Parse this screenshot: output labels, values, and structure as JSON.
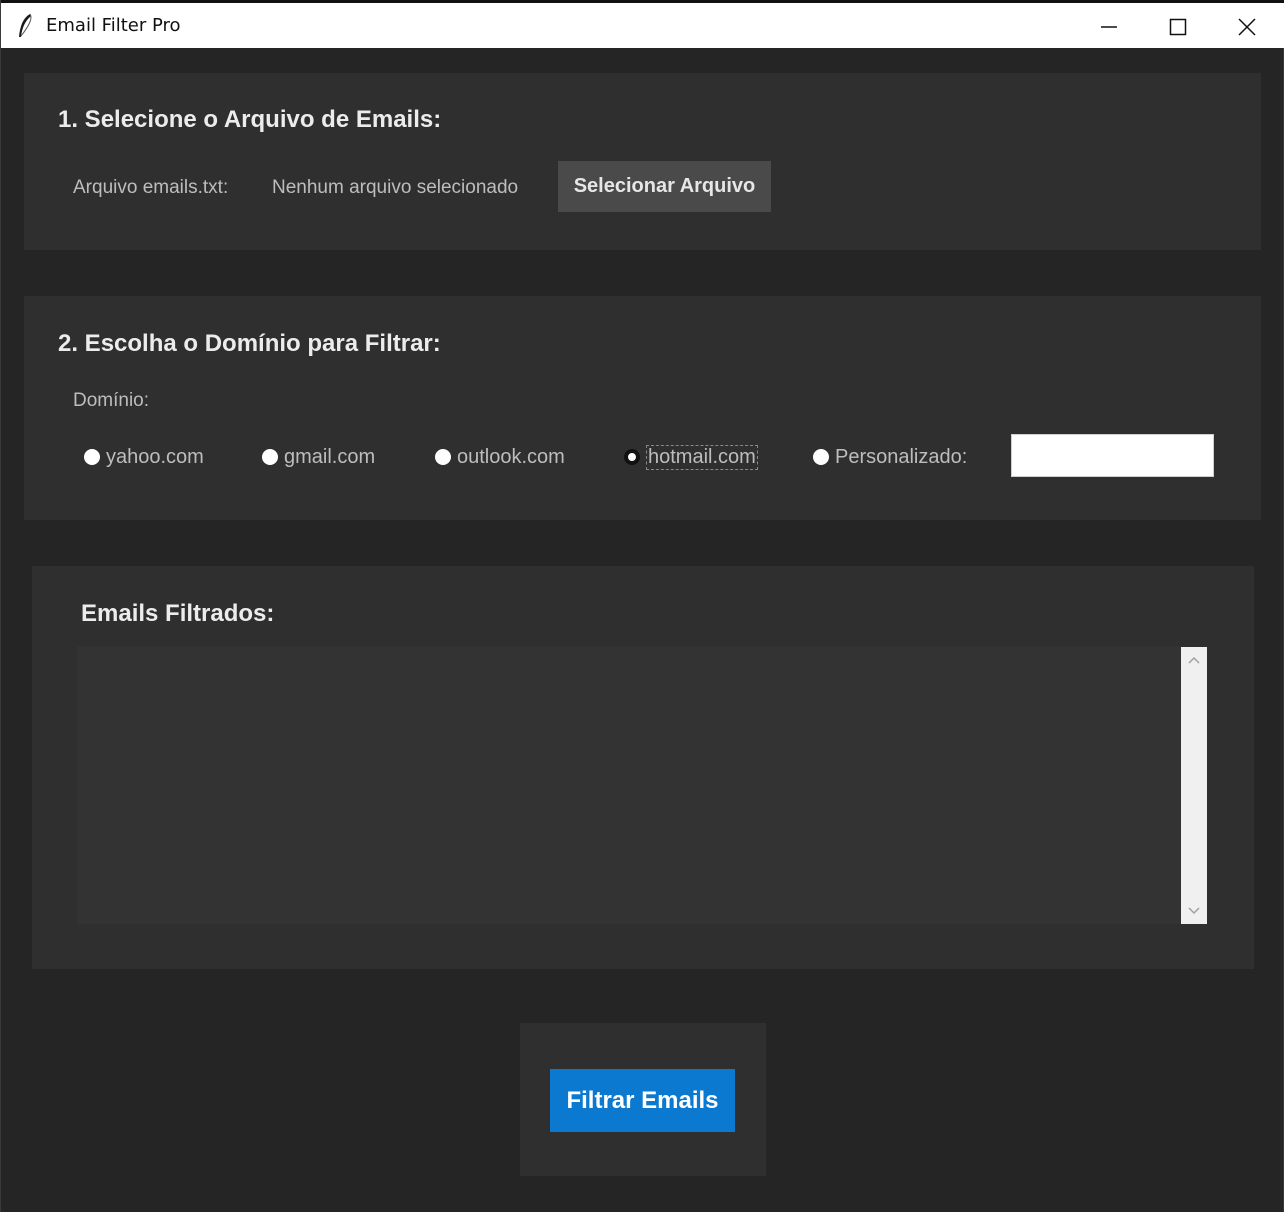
{
  "window": {
    "title": "Email Filter Pro",
    "icons": {
      "app": "feather-icon",
      "minimize": "minimize-icon",
      "maximize": "maximize-icon",
      "close": "close-icon"
    }
  },
  "section1": {
    "title": "1. Selecione o Arquivo de Emails:",
    "file_label": "Arquivo emails.txt:",
    "file_status": "Nenhum arquivo selecionado",
    "select_button": "Selecionar Arquivo"
  },
  "section2": {
    "title": "2. Escolha o Domínio para Filtrar:",
    "domain_label": "Domínio:",
    "options": [
      {
        "label": "yahoo.com",
        "selected": false
      },
      {
        "label": "gmail.com",
        "selected": false
      },
      {
        "label": "outlook.com",
        "selected": false
      },
      {
        "label": "hotmail.com",
        "selected": true
      },
      {
        "label": "Personalizado:",
        "selected": false
      }
    ],
    "custom_value": ""
  },
  "section3": {
    "title": "Emails Filtrados:",
    "content": ""
  },
  "actions": {
    "filter_button": "Filtrar Emails"
  },
  "colors": {
    "background": "#252525",
    "panel": "#2f2f2f",
    "accent": "#0b79d0",
    "button": "#4a4a4a"
  }
}
